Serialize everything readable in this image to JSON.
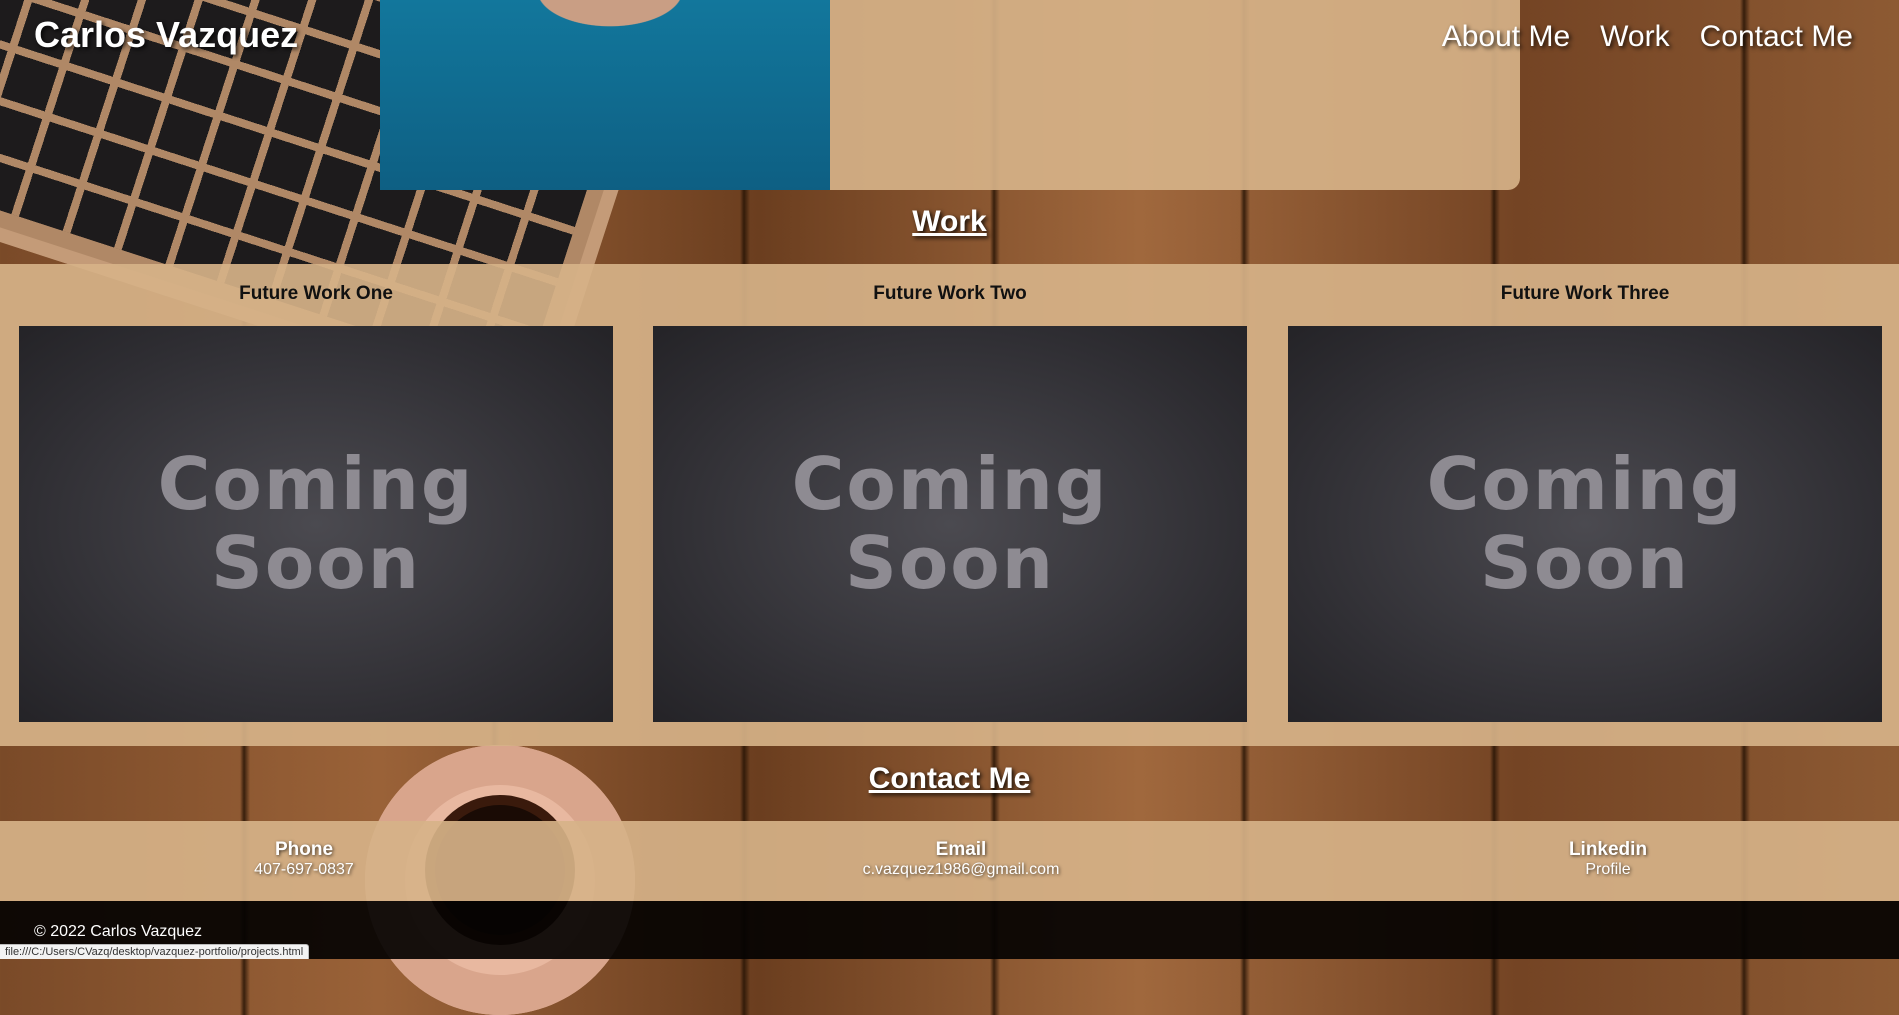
{
  "header": {
    "brand": "Carlos Vazquez",
    "nav": [
      "About Me",
      "Work",
      "Contact Me"
    ]
  },
  "work": {
    "title": "Work",
    "items": [
      {
        "title": "Future Work One",
        "image_line1": "Coming",
        "image_line2": "Soon"
      },
      {
        "title": "Future Work Two",
        "image_line1": "Coming",
        "image_line2": "Soon"
      },
      {
        "title": "Future Work Three",
        "image_line1": "Coming",
        "image_line2": "Soon"
      }
    ]
  },
  "contact": {
    "title": "Contact Me",
    "items": [
      {
        "label": "Phone",
        "value": "407-697-0837"
      },
      {
        "label": "Email",
        "value": "c.vazquez1986@gmail.com"
      },
      {
        "label": "Linkedin",
        "value": "Profile"
      }
    ]
  },
  "footer": {
    "copyright": "© 2022 Carlos Vazquez"
  },
  "statusbar": {
    "url": "file:///C:/Users/CVazq/desktop/vazquez-portfolio/projects.html"
  }
}
